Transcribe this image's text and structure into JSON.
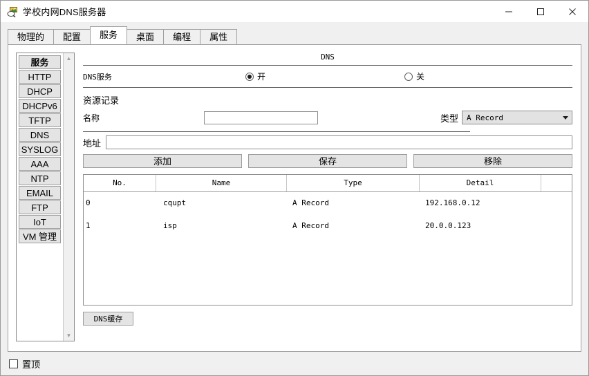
{
  "window": {
    "title": "学校内网DNS服务器",
    "icon": "dns-server-icon",
    "controls": {
      "minimize": "minimize-icon",
      "maximize": "maximize-icon",
      "close": "close-icon"
    }
  },
  "tabs": [
    {
      "label": "物理的",
      "active": false
    },
    {
      "label": "配置",
      "active": false
    },
    {
      "label": "服务",
      "active": true
    },
    {
      "label": "桌面",
      "active": false
    },
    {
      "label": "编程",
      "active": false
    },
    {
      "label": "属性",
      "active": false
    }
  ],
  "sidebar": {
    "items": [
      {
        "label": "服务",
        "header": true
      },
      {
        "label": "HTTP",
        "header": false
      },
      {
        "label": "DHCP",
        "header": false
      },
      {
        "label": "DHCPv6",
        "header": false
      },
      {
        "label": "TFTP",
        "header": false
      },
      {
        "label": "DNS",
        "header": false
      },
      {
        "label": "SYSLOG",
        "header": false
      },
      {
        "label": "AAA",
        "header": false
      },
      {
        "label": "NTP",
        "header": false
      },
      {
        "label": "EMAIL",
        "header": false
      },
      {
        "label": "FTP",
        "header": false
      },
      {
        "label": "IoT",
        "header": false
      },
      {
        "label": "VM 管理",
        "header": false
      }
    ],
    "scroll_up": "▲",
    "scroll_down": "▼"
  },
  "main": {
    "section_title": "DNS",
    "service_label": "DNS服务",
    "radio_on_label": "开",
    "radio_off_label": "关",
    "service_state": "on",
    "resource_records_label": "资源记录",
    "name_label": "名称",
    "name_value": "",
    "type_label": "类型",
    "type_value": "A Record",
    "type_options": [
      "A Record"
    ],
    "address_label": "地址",
    "address_value": "",
    "buttons": {
      "add": "添加",
      "save": "保存",
      "remove": "移除"
    },
    "table": {
      "columns": [
        "No.",
        "Name",
        "Type",
        "Detail",
        ""
      ],
      "rows": [
        {
          "no": "0",
          "name": "cqupt",
          "type": "A Record",
          "detail": "192.168.0.12"
        },
        {
          "no": "1",
          "name": "isp",
          "type": "A Record",
          "detail": "20.0.0.123"
        }
      ]
    },
    "dns_cache_button": "DNS缓存"
  },
  "footer": {
    "pin_label": "置顶",
    "pin_checked": false
  }
}
